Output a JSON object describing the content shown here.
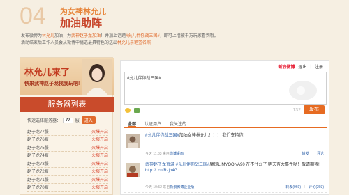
{
  "header": {
    "number": "04",
    "title": "为女神林允儿",
    "subtitle": "加油助阵"
  },
  "intro": {
    "line1_a": "发布微博为",
    "line1_b": "林允儿",
    "line1_c": "加油，为",
    "line1_d": "武神赵子龙加油",
    "line1_e": "！并加上话题",
    "line1_f": "#允儿伴你战三国#",
    "line1_g": "，即可上墙被千万玩家看到哦。",
    "line2_a": "活动结束后工作人员会从微博中挑选最具特色的送出",
    "line2_b": "林允儿亲笔签名照"
  },
  "banner": {
    "title": "林允儿来了",
    "tagline": "快来武神赵子龙找我玩吧!"
  },
  "servers": {
    "header": "服务器列表",
    "quick_label": "快速选择服务器：",
    "quick_num": "77",
    "quick_unit": "服",
    "go_label": "进入",
    "rows": [
      {
        "name": "赵子龙77服",
        "status": "火爆开启"
      },
      {
        "name": "赵子龙76服",
        "status": "火爆开启"
      },
      {
        "name": "赵子龙75服",
        "status": "火爆开启"
      },
      {
        "name": "赵子龙74服",
        "status": "火爆开启"
      },
      {
        "name": "赵子龙73服",
        "status": "火爆开启"
      },
      {
        "name": "赵子龙72服",
        "status": "火爆开启"
      },
      {
        "name": "赵子龙71服",
        "status": "火爆开启"
      },
      {
        "name": "赵子龙70服",
        "status": "火爆开启"
      }
    ]
  },
  "weibo": {
    "brand": "新浪微博",
    "logout": "退出",
    "register": "注册",
    "editor_text": "#允儿伴你战三国#",
    "char_count": "132",
    "post_label": "发布",
    "tabs": [
      "全部",
      "认证用户",
      "我关注的"
    ],
    "feed": [
      {
        "text_link": "#允儿伴你战三国#",
        "text": "加油女神林允儿！！！ 我们支持你!",
        "time": "今天 11:33",
        "source_prefix": "来自",
        "source": "微博桌面",
        "actions": [
          "转发",
          "评论"
        ]
      },
      {
        "author": "武神赵子龙页游",
        "text_link": "#允儿伴你战三国#",
        "text": "魔镜LIMYOONA90 在不什么了 明天有大事件呦！敬请期待!",
        "url": "http://t.cn/Rzjh4G...",
        "time": "今天 10:52",
        "source_prefix": "来自",
        "source": "新浪微博企业版",
        "actions": [
          "转发(969)",
          "评论(203)"
        ]
      }
    ]
  }
}
